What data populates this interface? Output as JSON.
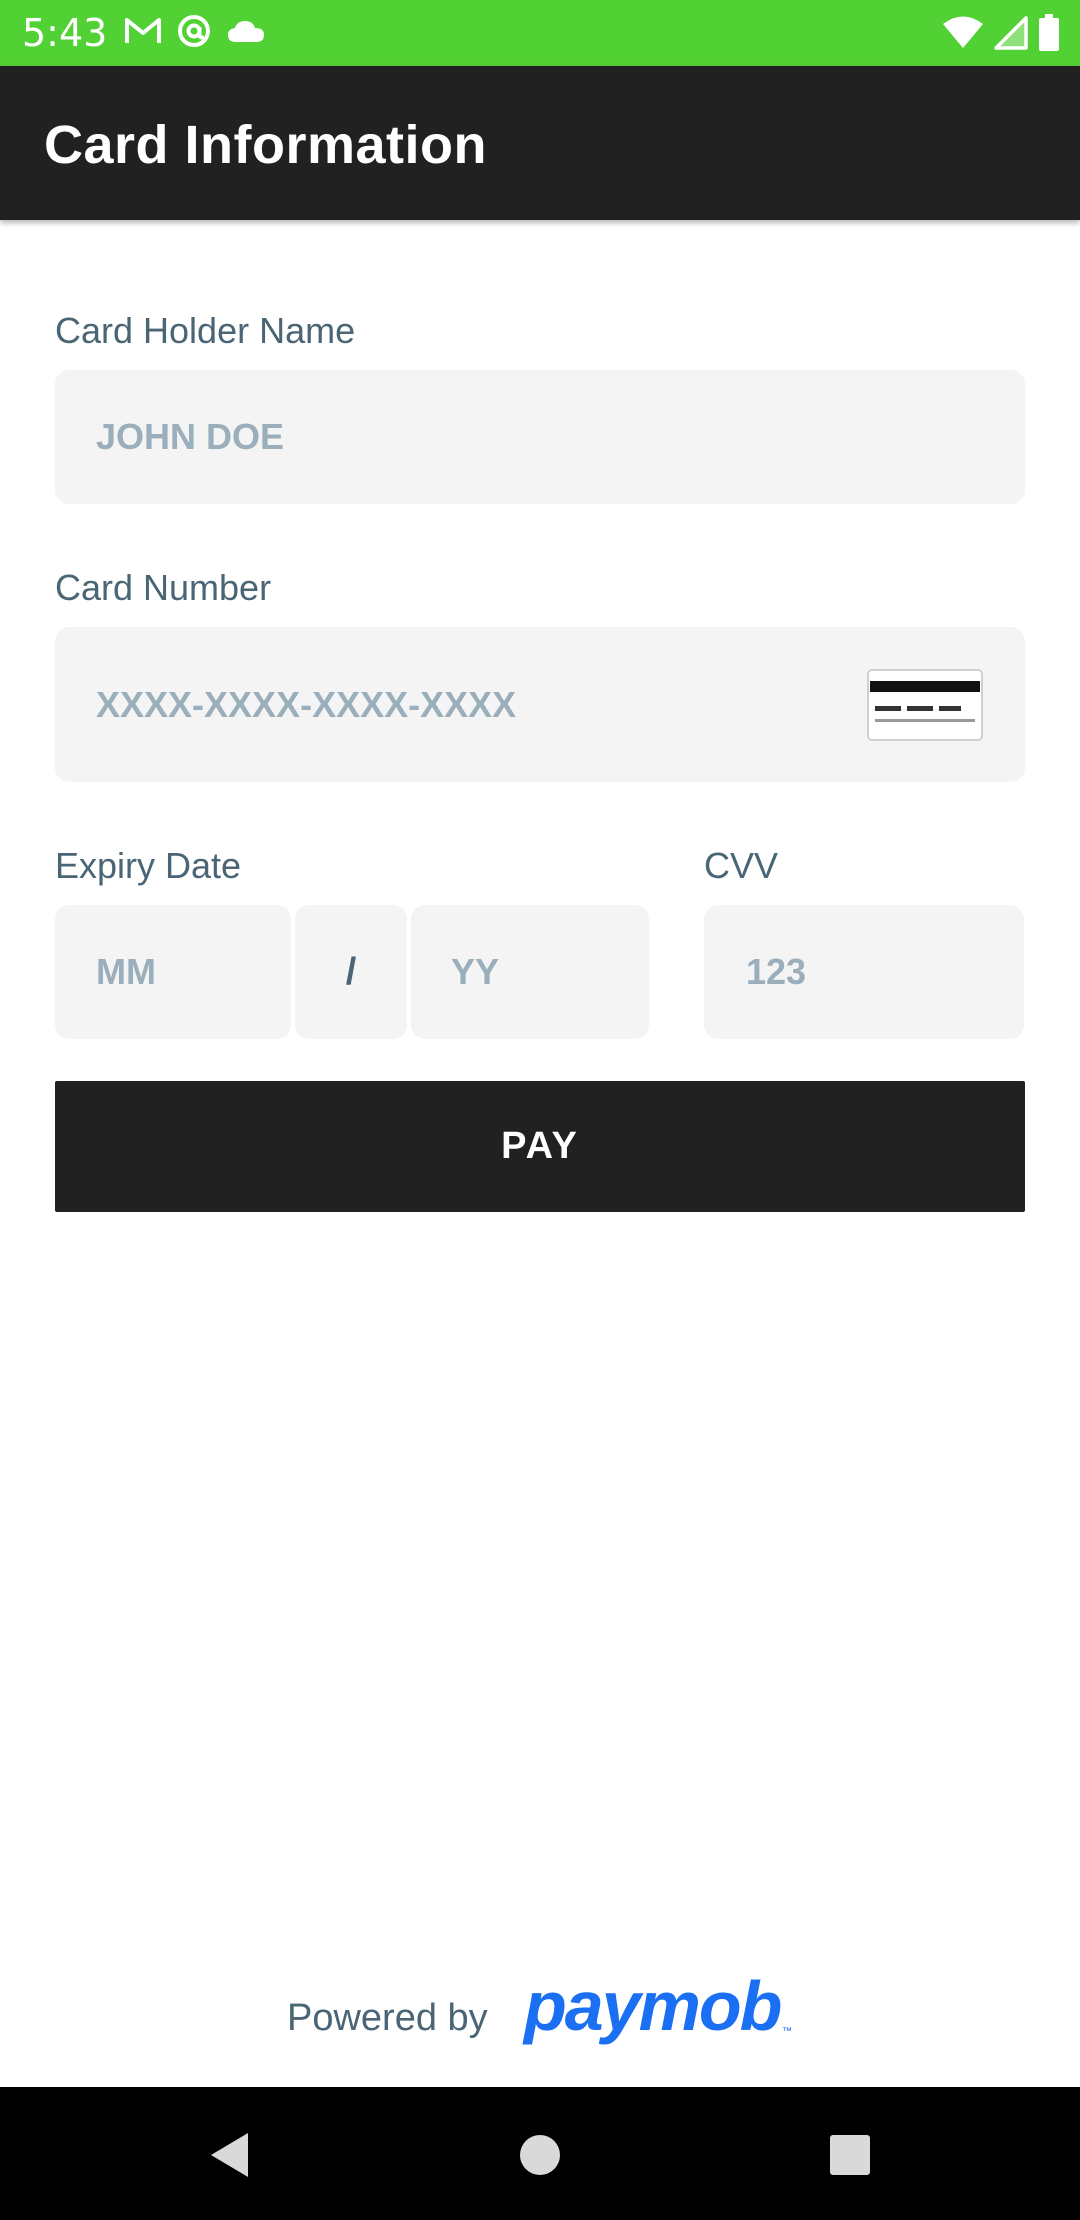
{
  "status_bar": {
    "time": "5:43",
    "left_icons": [
      "gmail-icon",
      "at-sign-icon",
      "cloud-icon"
    ],
    "right_icons": [
      "wifi-icon",
      "cellular-signal-icon",
      "battery-icon"
    ],
    "background_color": "#52d134"
  },
  "app_bar": {
    "title": "Card Information",
    "background_color": "#212121"
  },
  "form": {
    "card_holder": {
      "label": "Card Holder Name",
      "value": "",
      "placeholder": "JOHN DOE"
    },
    "card_number": {
      "label": "Card Number",
      "value": "",
      "placeholder": "XXXX-XXXX-XXXX-XXXX",
      "icon": "credit-card-icon"
    },
    "expiry": {
      "label": "Expiry Date",
      "month_placeholder": "MM",
      "separator": "/",
      "year_placeholder": "YY"
    },
    "cvv": {
      "label": "CVV",
      "value": "",
      "placeholder": "123"
    }
  },
  "pay_button": {
    "label": "PAY"
  },
  "footer": {
    "powered_by": "Powered by",
    "logo_text": "paymob",
    "logo_color": "#1b6ff2"
  },
  "nav_bar": {
    "buttons": [
      "back-icon",
      "home-icon",
      "recents-icon"
    ]
  }
}
